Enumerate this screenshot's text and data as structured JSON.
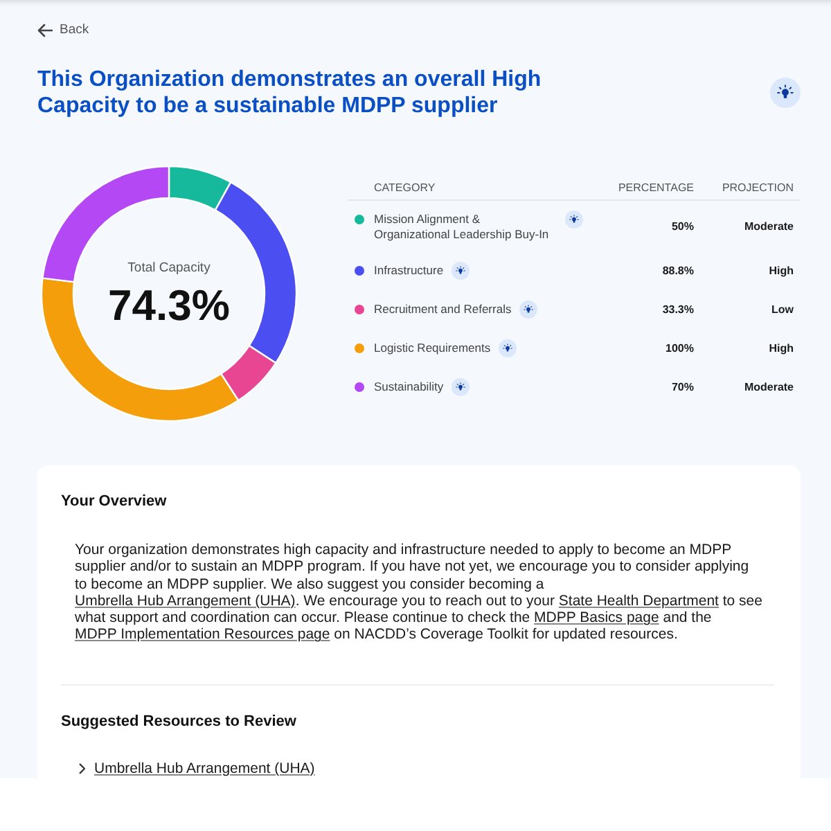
{
  "back_link": {
    "label": "Back"
  },
  "title": "This Organization demonstrates an overall High Capacity to be a sustainable MDPP supplier",
  "summary": {
    "label": "Total Capacity",
    "value": "74.3%"
  },
  "table": {
    "columns": [
      "CATEGORY",
      "PERCENTAGE",
      "PROJECTION"
    ],
    "rows": [
      {
        "category": "Mission Alignment & Organizational Leadership Buy-In",
        "color": "#17b99d",
        "percentage": "50%",
        "projection": "Moderate"
      },
      {
        "category": "Infrastructure",
        "color": "#4b4ef0",
        "percentage": "88.8%",
        "projection": "High"
      },
      {
        "category": "Recruitment and Referrals",
        "color": "#e84593",
        "percentage": "33.3%",
        "projection": "Low"
      },
      {
        "category": "Logistic Requirements",
        "color": "#f59e0b",
        "percentage": "100%",
        "projection": "High"
      },
      {
        "category": "Sustainability",
        "color": "#b548f5",
        "percentage": "70%",
        "projection": "Moderate"
      }
    ]
  },
  "overview": {
    "title": "Your Overview",
    "paragraph": [
      {
        "kind": "text",
        "text": "Your organization demonstrates high capacity and infrastructure needed to apply to become an MDPP supplier and/or to sustain an MDPP program. If you have not yet, we encourage you to consider applying to become an MDPP supplier. We also suggest you consider becoming a "
      },
      {
        "kind": "link",
        "text": "Umbrella Hub Arrangement (UHA)"
      },
      {
        "kind": "text",
        "text": ". We encourage you to reach out to your "
      },
      {
        "kind": "link",
        "text": "State Health Department"
      },
      {
        "kind": "text",
        "text": " to see what support and coordination can occur. Please continue to check the "
      },
      {
        "kind": "link",
        "text": "MDPP Basics page"
      },
      {
        "kind": "text",
        "text": " and the "
      },
      {
        "kind": "link",
        "text": "MDPP Implementation Resources page"
      },
      {
        "kind": "text",
        "text": " on NACDD’s Coverage Toolkit for updated resources."
      }
    ]
  },
  "resources": {
    "title": "Suggested Resources to Review",
    "items": [
      {
        "label": "Umbrella Hub Arrangement (UHA)"
      }
    ]
  }
}
